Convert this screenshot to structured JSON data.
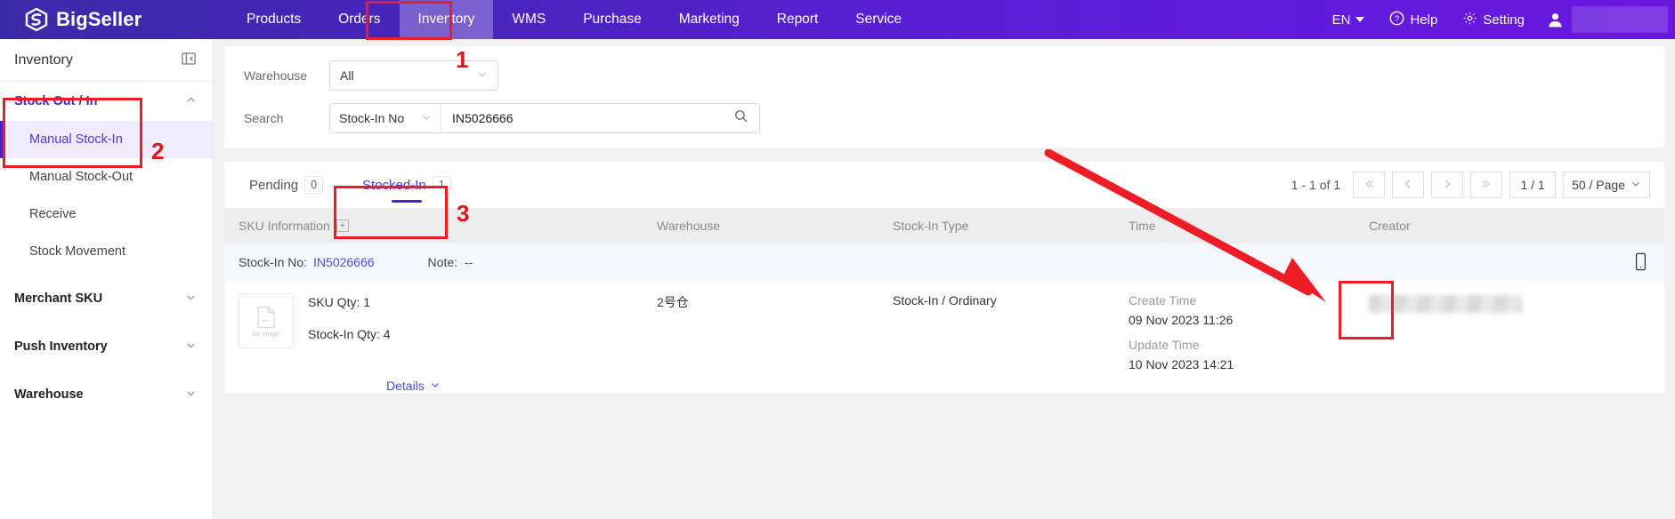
{
  "header": {
    "brand": "BigSeller",
    "brand_logo_icon": "bigseller-logo-icon",
    "nav": [
      {
        "label": "Products",
        "active": false
      },
      {
        "label": "Orders",
        "active": false
      },
      {
        "label": "Inventory",
        "active": true
      },
      {
        "label": "WMS",
        "active": false
      },
      {
        "label": "Purchase",
        "active": false
      },
      {
        "label": "Marketing",
        "active": false
      },
      {
        "label": "Report",
        "active": false
      },
      {
        "label": "Service",
        "active": false
      }
    ],
    "language": "EN",
    "help": "Help",
    "setting": "Setting",
    "account_redacted": true
  },
  "sidebar": {
    "title": "Inventory",
    "collapse_icon": "collapse-panel-icon",
    "groups": [
      {
        "label": "Stock Out / In",
        "open": true,
        "chevron": "chevron-up-icon",
        "items": [
          {
            "label": "Manual Stock-In",
            "active": true
          },
          {
            "label": "Manual Stock-Out",
            "active": false
          },
          {
            "label": "Receive",
            "active": false
          },
          {
            "label": "Stock Movement",
            "active": false
          }
        ]
      },
      {
        "label": "Merchant SKU",
        "open": false,
        "chevron": "chevron-down-icon",
        "items": []
      },
      {
        "label": "Push Inventory",
        "open": false,
        "chevron": "chevron-down-icon",
        "items": []
      },
      {
        "label": "Warehouse",
        "open": false,
        "chevron": "chevron-down-icon",
        "items": []
      }
    ]
  },
  "filters": {
    "warehouse_label": "Warehouse",
    "warehouse_value": "All",
    "search_label": "Search",
    "search_type_value": "Stock-In No",
    "search_value": "IN5026666",
    "search_placeholder": "",
    "search_icon": "search-icon"
  },
  "tabs": [
    {
      "label": "Pending",
      "count": "0",
      "active": false
    },
    {
      "label": "Stocked-In",
      "count": "1",
      "active": true
    }
  ],
  "pagination": {
    "range": "1 - 1 of 1",
    "first_icon": "double-chevron-left-icon",
    "prev_icon": "chevron-left-icon",
    "next_icon": "chevron-right-icon",
    "last_icon": "double-chevron-right-icon",
    "page": "1 / 1",
    "page_size": "50 / Page"
  },
  "table": {
    "columns": [
      {
        "label": "SKU Information",
        "icon": "expand-all-box-icon"
      },
      {
        "label": "Warehouse",
        "icon": ""
      },
      {
        "label": "Stock-In Type",
        "icon": ""
      },
      {
        "label": "Time",
        "icon": ""
      },
      {
        "label": "Creator",
        "icon": ""
      }
    ],
    "rows": [
      {
        "stock_in_no_label": "Stock-In No:",
        "stock_in_no_value": "IN5026666",
        "note_label": "Note:",
        "note_value": "--",
        "image_placeholder": "No Image",
        "sku_qty": "SKU Qty: 1",
        "stock_in_qty": "Stock-In Qty: 4",
        "details_label": "Details",
        "details_chevron": "chevron-down-icon",
        "warehouse": "2号仓",
        "stock_in_type": "Stock-In / Ordinary",
        "create_time_label": "Create Time",
        "create_time_value": "09 Nov 2023 11:26",
        "update_time_label": "Update Time",
        "update_time_value": "10 Nov 2023 14:21",
        "creator_redacted": true,
        "action_icon": "mobile-device-icon"
      }
    ]
  },
  "annotations": {
    "accent_color": "#ee1c25",
    "markers": [
      {
        "number": "1",
        "target": "Inventory nav tab"
      },
      {
        "number": "2",
        "target": "Manual Stock-In sidebar item"
      },
      {
        "number": "3",
        "target": "Stocked-In tab"
      }
    ],
    "arrow": {
      "points_to": "row action mobile-device-icon"
    }
  }
}
